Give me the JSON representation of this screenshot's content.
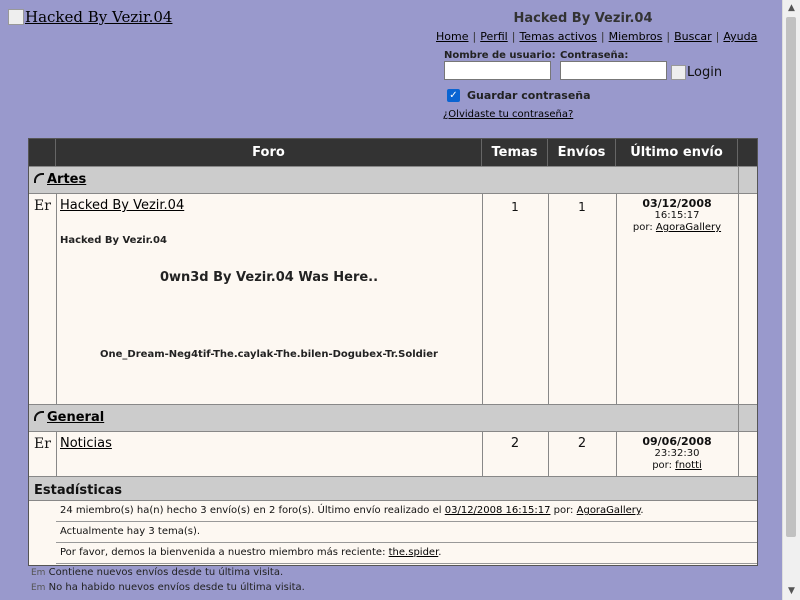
{
  "header": {
    "logo_alt": "Hacked By Vezir.04",
    "site_title": "Hacked By Vezir.04",
    "nav": [
      "Home",
      "Perfil",
      "Temas activos",
      "Miembros",
      "Buscar",
      "Ayuda"
    ],
    "username_label": "Nombre de usuario:",
    "password_label": "Contraseña:",
    "username_value": "",
    "password_value": "",
    "login_label": "Login",
    "remember_label": "Guardar contraseña",
    "remember_checked": true,
    "forgot_link": "¿Olvidaste tu contraseña?"
  },
  "table": {
    "headers": [
      "Foro",
      "Temas",
      "Envíos",
      "Último envío"
    ],
    "categories": [
      {
        "title": "Artes",
        "forums": [
          {
            "icon": "Er",
            "name": "Hacked By Vezir.04",
            "desc_small": "Hacked By Vezir.04",
            "desc_big": "0wn3d By Vezir.04 Was Here..",
            "desc_team": "One_Dream-Neg4tif-The.caylak-The.bilen-Dogubex-Tr.Soldier",
            "topics": "1",
            "posts": "1",
            "last_date": "03/12/2008",
            "last_time": "16:15:17",
            "last_by_label": "por:",
            "last_user": "AgoraGallery"
          }
        ]
      },
      {
        "title": "General",
        "forums": [
          {
            "icon": "Er",
            "name": "Noticias",
            "topics": "2",
            "posts": "2",
            "last_date": "09/06/2008",
            "last_time": "23:32:30",
            "last_by_label": "por:",
            "last_user": "fnotti"
          }
        ]
      }
    ]
  },
  "stats": {
    "title": "Estadísticas",
    "line1_prefix": "24 miembro(s) ha(n) hecho 3 envío(s) en 2 foro(s). Último envío realizado el",
    "line1_link": "03/12/2008 16:15:17",
    "line1_by": "por:",
    "line1_user": "AgoraGallery",
    "line1_end": ".",
    "line2": "Actualmente hay 3 tema(s).",
    "line3_prefix": "Por favor, demos la bienvenida a nuestro miembro más reciente:",
    "line3_user": "the.spider",
    "line3_end": "."
  },
  "legend": {
    "icon": "Em",
    "new_posts": "Contiene nuevos envíos desde tu última visita.",
    "no_new_posts": "No ha habido nuevos envíos desde tu última visita."
  },
  "colors": {
    "page_bg": "#9999cc",
    "header_bar": "#333333",
    "category_bg": "#cccccc",
    "row_bg": "#fdf8f2",
    "checkbox": "#0a64d2"
  }
}
